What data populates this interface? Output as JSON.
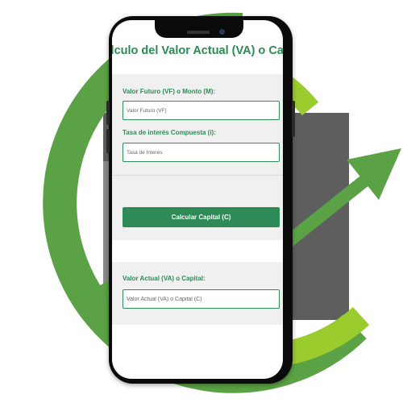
{
  "header": {
    "title": "Cálculo del Valor Actual (VA) o Capital"
  },
  "form": {
    "future_value_label": "Valor Futuro (VF) o Monto (M):",
    "future_value_placeholder": "Valor Futuro (VF)",
    "rate_label": "Tasa de interés Compuesta (i):",
    "rate_placeholder": "Tasa de Interés",
    "calculate_button": "Calcular Capital (C)"
  },
  "result": {
    "label": "Valor Actual (VA) o Capital:",
    "placeholder": "Valor Actual (VA) o Capital (C)"
  },
  "colors": {
    "brand_green": "#2e8b57",
    "lime_green": "#9bcc2e",
    "logo_green": "#5aa245",
    "logo_gray": "#5f5e5f"
  },
  "icons": {
    "background_logo": "growth-arrow-logo-icon"
  }
}
